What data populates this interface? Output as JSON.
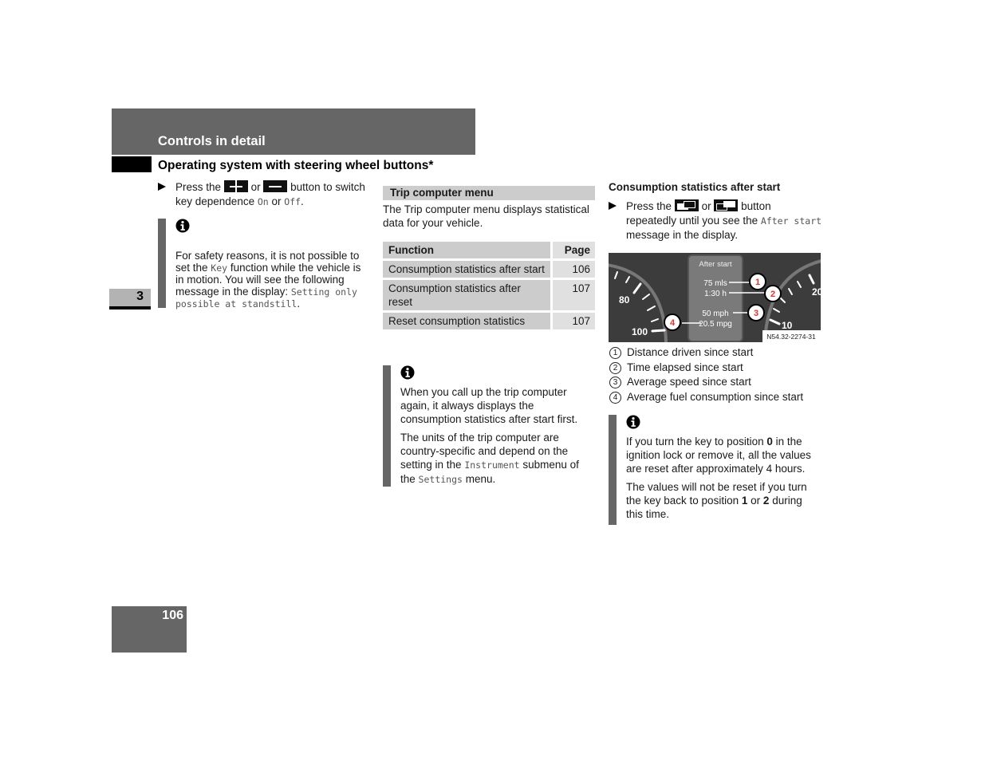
{
  "header": {
    "chapter_title": "Controls in detail",
    "section_title": "Operating system with steering wheel buttons*",
    "chapter_number": "3",
    "page_number": "106"
  },
  "left_column": {
    "instruction": {
      "prefix": "Press the",
      "button1": "plus-button",
      "middle": "or",
      "button2": "minus-button",
      "suffix": "button to switch key dependence",
      "value_on": "On",
      "conj": "or",
      "value_off": "Off",
      "end": "."
    },
    "note": {
      "text1": "For safety reasons, it is not possible to set the",
      "key_term": "Key",
      "text2": "function while the vehicle is in motion. You will see the following message in the display:",
      "display_message": "Setting only possible at standstill",
      "end": "."
    }
  },
  "middle_column": {
    "subheading": "Trip computer menu",
    "intro": "The Trip computer menu displays statistical data for your vehicle.",
    "table": {
      "headers": [
        "Function",
        "Page"
      ],
      "rows": [
        {
          "function": "Consumption statistics after start",
          "page": "106"
        },
        {
          "function": "Consumption statistics after reset",
          "page": "107"
        },
        {
          "function": "Reset consumption statistics",
          "page": "107"
        }
      ]
    },
    "note": {
      "para1": "When you call up the trip computer again, it always displays the consumption statistics after start first.",
      "para2_a": "The units of the trip computer are country-specific and depend on the setting in the",
      "instrument_term": "Instrument",
      "para2_b": "submenu of the",
      "settings_term": "Settings",
      "para2_c": "menu."
    }
  },
  "right_column": {
    "heading": "Consumption statistics after start",
    "instruction": {
      "prefix": "Press the",
      "middle": "or",
      "suffix": "button repeatedly until you see the",
      "display_term": "After start",
      "end": "message in the display."
    },
    "figure": {
      "display_title": "After start",
      "values": [
        "75 mls",
        "1:30 h",
        "50 mph",
        "20.5 mpg"
      ],
      "callouts": [
        "1",
        "2",
        "3",
        "4"
      ],
      "left_gauge_labels": [
        "80",
        "100"
      ],
      "right_gauge_labels": [
        "20",
        "10"
      ],
      "figure_id": "N54.32-2274-31"
    },
    "legend": [
      {
        "num": "1",
        "text": "Distance driven since start"
      },
      {
        "num": "2",
        "text": "Time elapsed since start"
      },
      {
        "num": "3",
        "text": "Average speed since start"
      },
      {
        "num": "4",
        "text": "Average fuel consumption since start"
      }
    ],
    "note": {
      "p1_a": "If you turn the key to position",
      "p1_pos": "0",
      "p1_b": "in the ignition lock or remove it, all the values are reset after approximately 4 hours.",
      "p2_a": "The values will not be reset if you turn the key back to position",
      "p2_pos1": "1",
      "p2_or": "or",
      "p2_pos2": "2",
      "p2_b": "during this time."
    }
  },
  "colors": {
    "band_gray": "#666666",
    "table_gray": "#cccccc",
    "callout_red": "#e8322a"
  }
}
